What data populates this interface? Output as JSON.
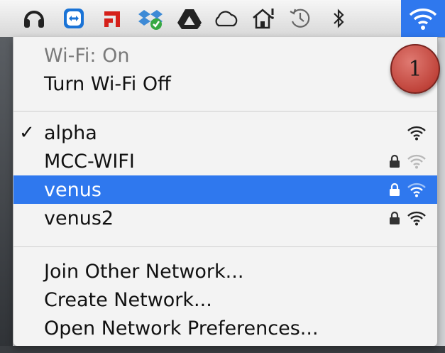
{
  "menubar": {
    "icons": [
      "headphones-icon",
      "teamviewer-icon",
      "flashget-icon",
      "dropbox-icon",
      "google-drive-icon",
      "cloud-icon",
      "home-sync-icon",
      "time-machine-icon",
      "bluetooth-icon",
      "wifi-icon"
    ],
    "accent": "#2f78ee"
  },
  "wifi_menu": {
    "status": "Wi-Fi: On",
    "toggle_label": "Turn Wi-Fi Off",
    "networks": [
      {
        "name": "alpha",
        "checked": true,
        "locked": false
      },
      {
        "name": "MCC-WIFI",
        "checked": false,
        "locked": true
      },
      {
        "name": "venus",
        "checked": false,
        "locked": true,
        "highlighted": true
      },
      {
        "name": "venus2",
        "checked": false,
        "locked": true
      }
    ],
    "check_mark": "✓",
    "actions": [
      "Join Other Network...",
      "Create Network...",
      "Open Network Preferences..."
    ]
  },
  "annotation": {
    "number": "1"
  }
}
